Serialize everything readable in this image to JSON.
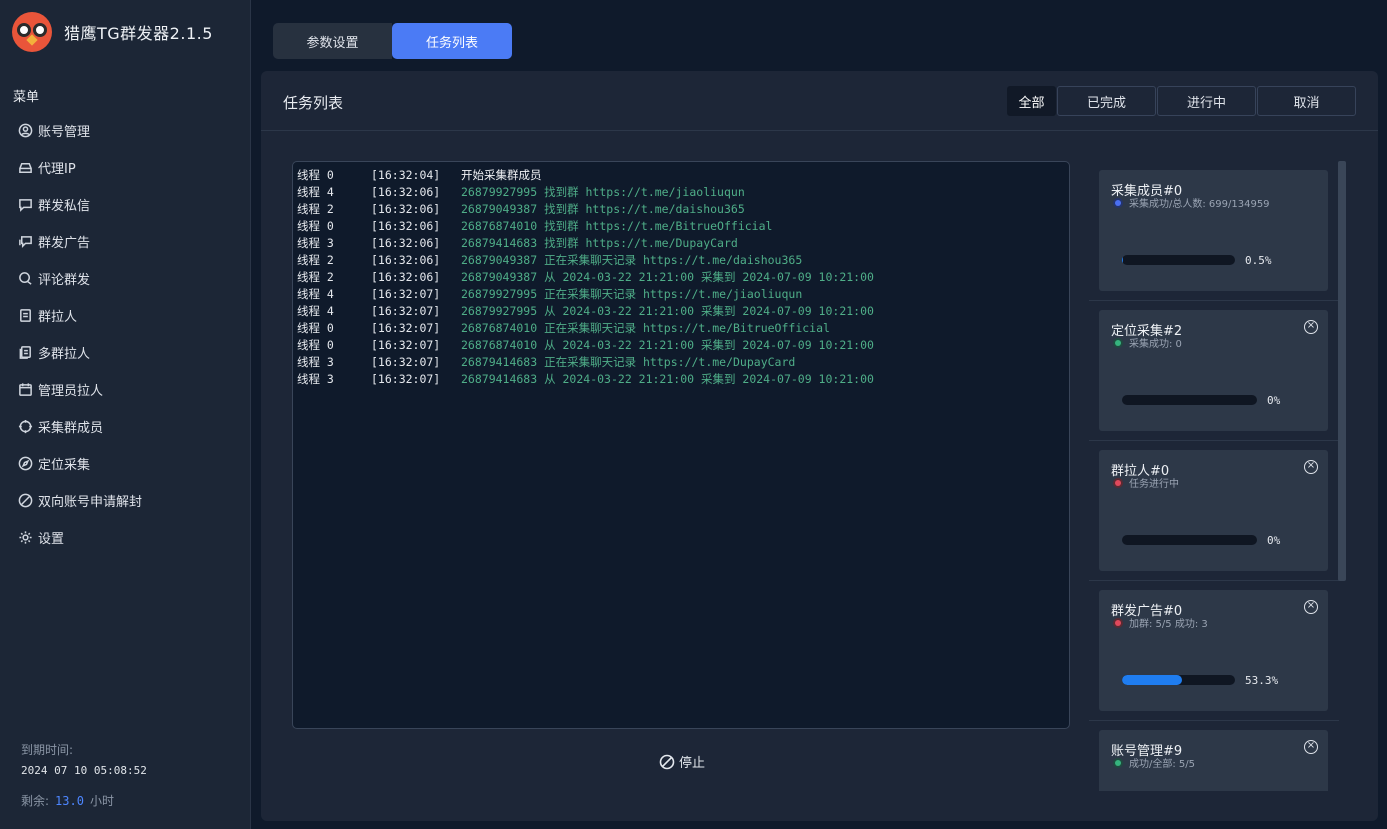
{
  "app": {
    "title": "猎鹰TG群发器2.1.5"
  },
  "sidebar": {
    "heading": "菜单",
    "items": [
      {
        "label": "账号管理",
        "icon": "user-circle-icon"
      },
      {
        "label": "代理IP",
        "icon": "server-icon"
      },
      {
        "label": "群发私信",
        "icon": "message-icon"
      },
      {
        "label": "群发广告",
        "icon": "chat-icon"
      },
      {
        "label": "评论群发",
        "icon": "comment-icon"
      },
      {
        "label": "群拉人",
        "icon": "document-icon"
      },
      {
        "label": "多群拉人",
        "icon": "documents-icon"
      },
      {
        "label": "管理员拉人",
        "icon": "calendar-icon"
      },
      {
        "label": "采集群成员",
        "icon": "crosshair-icon"
      },
      {
        "label": "定位采集",
        "icon": "compass-icon"
      },
      {
        "label": "双向账号申请解封",
        "icon": "ban-icon"
      },
      {
        "label": "设置",
        "icon": "gear-icon"
      }
    ],
    "expire_label": "到期时间:",
    "expire_time": "2024 07 10 05:08:52",
    "remain_label": "剩余:",
    "remain_value": "13.0",
    "remain_unit": "小时"
  },
  "tabs": [
    {
      "label": "参数设置",
      "active": false
    },
    {
      "label": "任务列表",
      "active": true
    }
  ],
  "panel": {
    "title": "任务列表",
    "filters": [
      "全部",
      "已完成",
      "进行中",
      "取消"
    ],
    "active_filter": "全部",
    "stop_label": "停止"
  },
  "log": [
    {
      "thread": "线程 0",
      "time": "[16:32:04]",
      "msg": "开始采集群成员",
      "plain": true
    },
    {
      "thread": "线程 4",
      "time": "[16:32:06]",
      "msg": "26879927995 找到群 https://t.me/jiaoliuqun"
    },
    {
      "thread": "线程 2",
      "time": "[16:32:06]",
      "msg": "26879049387 找到群 https://t.me/daishou365"
    },
    {
      "thread": "线程 0",
      "time": "[16:32:06]",
      "msg": "26876874010 找到群 https://t.me/BitrueOfficial"
    },
    {
      "thread": "线程 3",
      "time": "[16:32:06]",
      "msg": "26879414683 找到群 https://t.me/DupayCard"
    },
    {
      "thread": "线程 2",
      "time": "[16:32:06]",
      "msg": "26879049387 正在采集聊天记录 https://t.me/daishou365"
    },
    {
      "thread": "线程 2",
      "time": "[16:32:06]",
      "msg": "26879049387 从 2024-03-22 21:21:00 采集到 2024-07-09 10:21:00"
    },
    {
      "thread": "线程 4",
      "time": "[16:32:07]",
      "msg": "26879927995 正在采集聊天记录 https://t.me/jiaoliuqun"
    },
    {
      "thread": "线程 4",
      "time": "[16:32:07]",
      "msg": "26879927995 从 2024-03-22 21:21:00 采集到 2024-07-09 10:21:00"
    },
    {
      "thread": "线程 0",
      "time": "[16:32:07]",
      "msg": "26876874010 正在采集聊天记录 https://t.me/BitrueOfficial"
    },
    {
      "thread": "线程 0",
      "time": "[16:32:07]",
      "msg": "26876874010 从 2024-03-22 21:21:00 采集到 2024-07-09 10:21:00"
    },
    {
      "thread": "线程 3",
      "time": "[16:32:07]",
      "msg": "26879414683 正在采集聊天记录 https://t.me/DupayCard"
    },
    {
      "thread": "线程 3",
      "time": "[16:32:07]",
      "msg": "26879414683 从 2024-03-22 21:21:00 采集到 2024-07-09 10:21:00"
    }
  ],
  "tasks": [
    {
      "title": "采集成员#0",
      "status": "采集成功/总人数: 699/134959",
      "status_color": "blue",
      "closable": false,
      "progress": 0.005,
      "percent": "0.5%"
    },
    {
      "title": "定位采集#2",
      "status": "采集成功: 0",
      "status_color": "green",
      "closable": true,
      "progress": 0,
      "percent": "0%"
    },
    {
      "title": "群拉人#0",
      "status": "任务进行中",
      "status_color": "red",
      "closable": true,
      "progress": 0,
      "percent": "0%"
    },
    {
      "title": "群发广告#0",
      "status": "加群: 5/5    成功: 3",
      "status_color": "red",
      "closable": true,
      "progress": 0.533,
      "percent": "53.3%"
    },
    {
      "title": "账号管理#9",
      "status": "成功/全部: 5/5",
      "status_color": "green",
      "closable": true,
      "progress": null,
      "percent": ""
    }
  ],
  "colors": {
    "accent": "#4b7bf5",
    "progress": "#1f7df0",
    "log_green": "#4fae88"
  }
}
